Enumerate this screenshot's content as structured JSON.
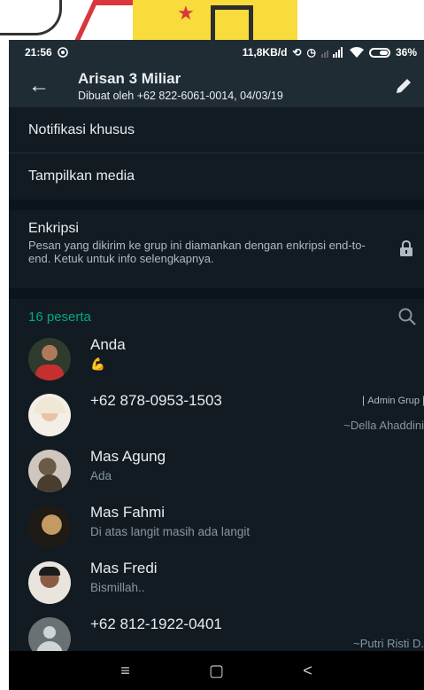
{
  "status_bar": {
    "time": "21:56",
    "network_speed": "11,8KB/d",
    "battery": "36%"
  },
  "header": {
    "title": "Arisan 3 Miliar",
    "subtitle": "Dibuat oleh +62 822-6061-0014, 04/03/19"
  },
  "settings": {
    "custom_notifications": "Notifikasi khusus",
    "media_visibility": "Tampilkan media"
  },
  "encryption": {
    "label": "Enkripsi",
    "description": "Pesan yang dikirim ke grup ini diamankan dengan enkripsi end-to-end. Ketuk untuk info selengkapnya."
  },
  "participants": {
    "count_label": "16 peserta",
    "members": [
      {
        "name": "Anda",
        "status": "💪",
        "badge": "",
        "pushname": ""
      },
      {
        "name": "+62 878-0953-1503",
        "status": "",
        "badge": "Admin Grup",
        "pushname": "~Della Ahaddini"
      },
      {
        "name": "Mas Agung",
        "status": "Ada",
        "badge": "",
        "pushname": ""
      },
      {
        "name": "Mas Fahmi",
        "status": "Di atas langit masih ada langit",
        "badge": "",
        "pushname": ""
      },
      {
        "name": "Mas Fredi",
        "status": "Bismillah..",
        "badge": "",
        "pushname": ""
      },
      {
        "name": "+62 812-1922-0401",
        "status": "",
        "badge": "",
        "pushname": "~Putri Risti D."
      }
    ]
  },
  "navbar": {
    "recents_icon": "≡",
    "home_icon": "▢",
    "back_icon": "<"
  },
  "colors": {
    "accent": "#00a884",
    "background": "#121b22",
    "appbar": "#1f2c34"
  }
}
